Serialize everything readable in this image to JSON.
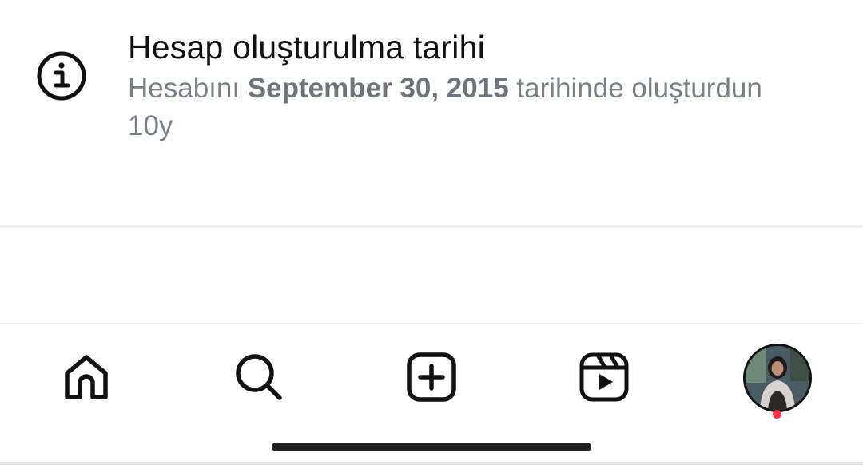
{
  "account_info": {
    "title": "Hesap oluşturulma tarihi",
    "desc_prefix": "Hesabını ",
    "date": "September 30, 2015",
    "desc_suffix": " tarihinde oluşturdun",
    "age": "10y",
    "icon": "info-icon"
  },
  "tab_bar": {
    "tabs": [
      {
        "name": "home",
        "icon": "home-icon"
      },
      {
        "name": "search",
        "icon": "search-icon"
      },
      {
        "name": "create",
        "icon": "plus-square-icon"
      },
      {
        "name": "reels",
        "icon": "reels-icon"
      },
      {
        "name": "profile",
        "icon": "avatar",
        "has_notification": true
      }
    ]
  },
  "colors": {
    "text_primary": "#111111",
    "text_secondary": "#7a7f87",
    "notification": "#ff3040",
    "background": "#ffffff"
  }
}
